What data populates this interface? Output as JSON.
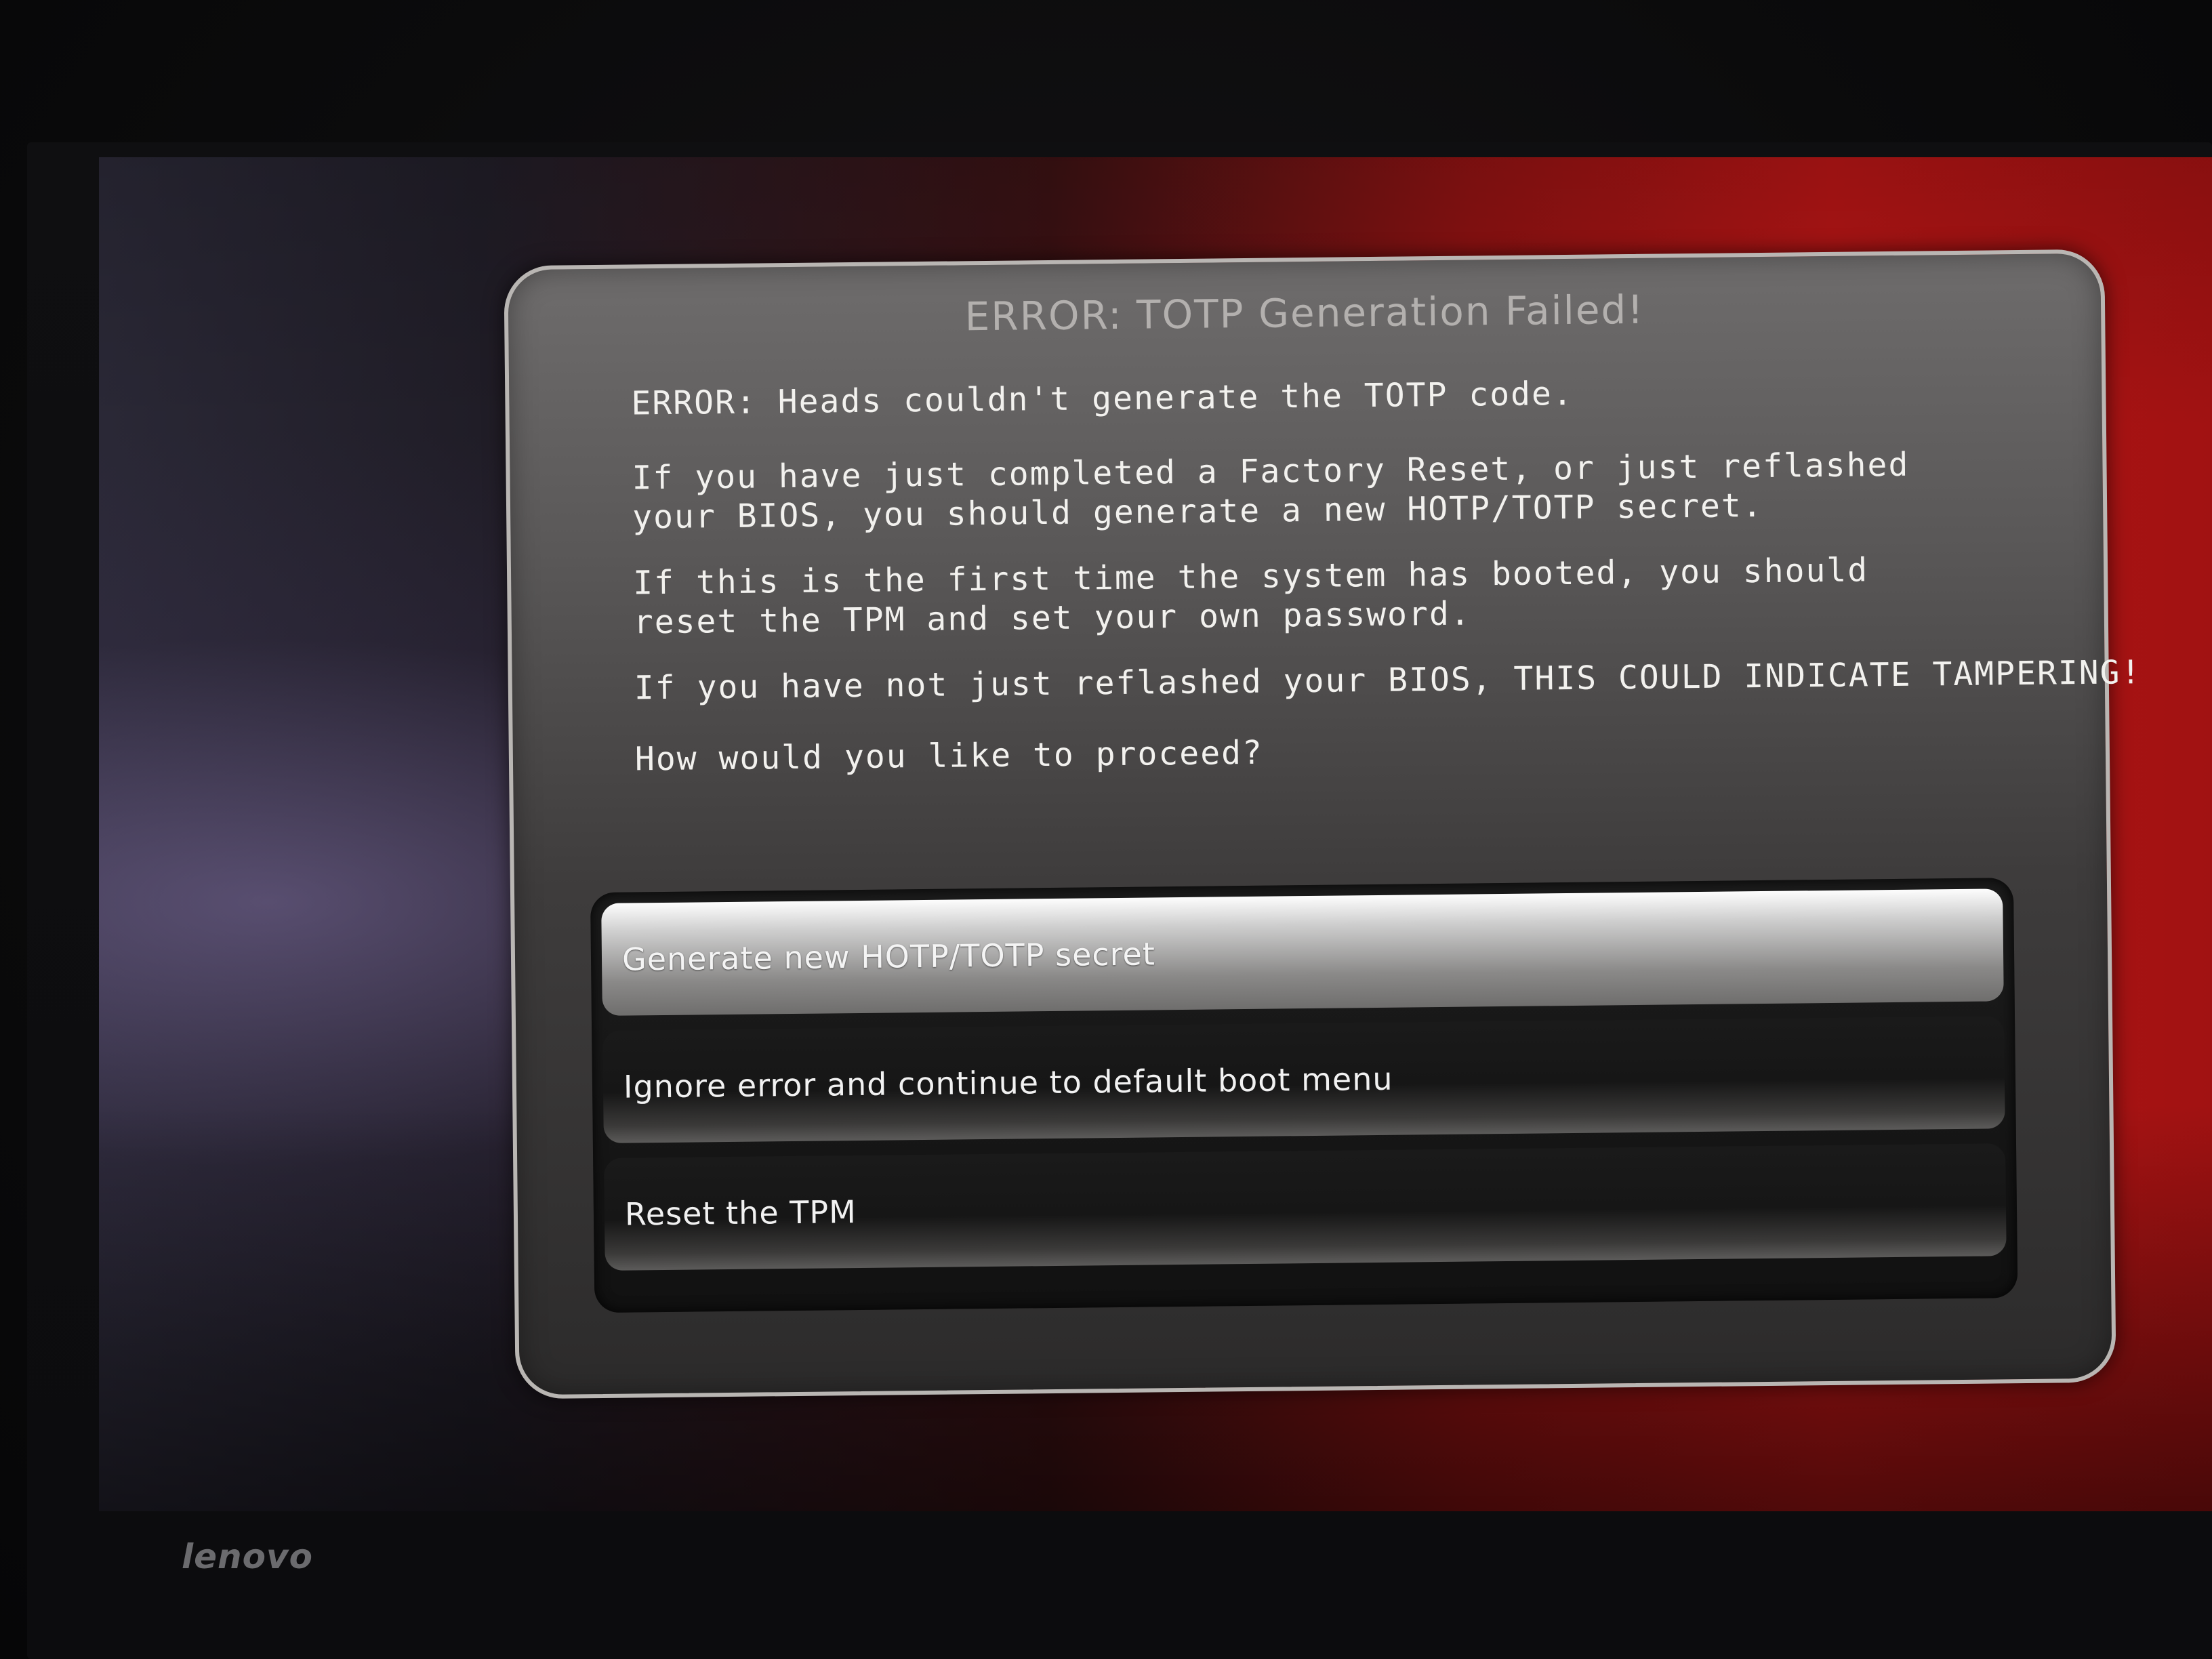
{
  "dialog": {
    "title": "ERROR: TOTP Generation Failed!",
    "messages": [
      "ERROR: Heads couldn't generate the TOTP code.",
      "If you have just completed a Factory Reset, or just reflashed\nyour BIOS, you should generate a new HOTP/TOTP secret.",
      "If this is the first time the system has booted, you should\nreset the TPM and set your own password.",
      "If you have not just reflashed your BIOS, THIS COULD INDICATE TAMPERING!",
      "How would you like to proceed?"
    ]
  },
  "menu": {
    "items": [
      {
        "label": "Generate new HOTP/TOTP secret",
        "selected": true
      },
      {
        "label": "Ignore error and continue to default boot menu",
        "selected": false
      },
      {
        "label": "Reset the TPM",
        "selected": false
      }
    ]
  },
  "bezel": {
    "brand": "lenovo"
  },
  "colors": {
    "background_red": "#b41515",
    "dialog_gray": "#5a5858",
    "text": "#f2f1ee"
  }
}
